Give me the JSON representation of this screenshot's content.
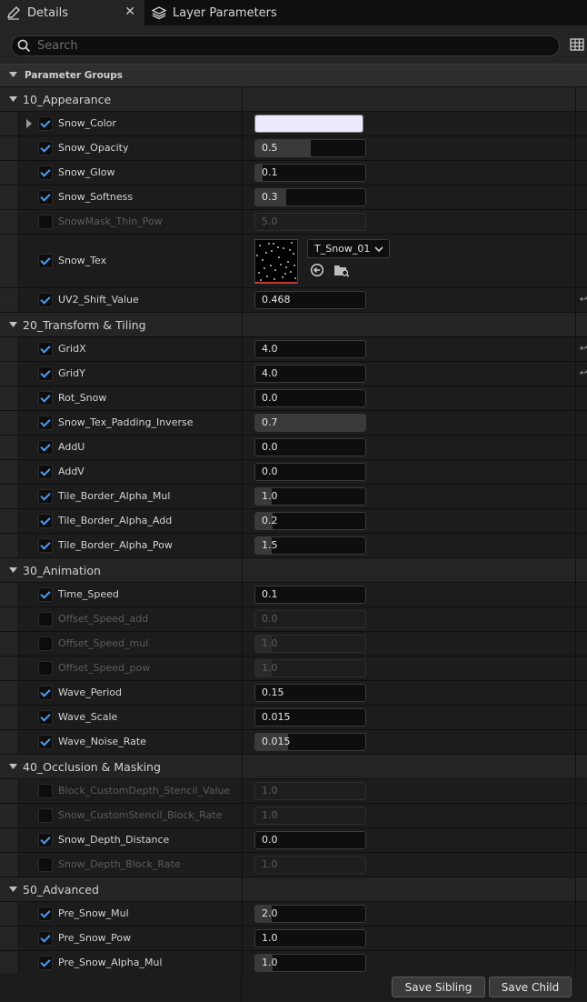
{
  "tabs": [
    {
      "label": "Details",
      "icon": "pencil-icon",
      "active": true
    },
    {
      "label": "Layer Parameters",
      "icon": "layers-icon",
      "active": false
    }
  ],
  "search": {
    "placeholder": "Search"
  },
  "header": {
    "label": "Parameter Groups"
  },
  "groups": [
    {
      "name": "10_Appearance",
      "params": [
        {
          "name": "Snow_Color",
          "checked": true,
          "type": "color",
          "color": "#ebeaff",
          "expandable": true
        },
        {
          "name": "Snow_Opacity",
          "checked": true,
          "value": "0.5",
          "fill": 0.5
        },
        {
          "name": "Snow_Glow",
          "checked": true,
          "value": "0.1",
          "fill": 0.07
        },
        {
          "name": "Snow_Softness",
          "checked": true,
          "value": "0.3",
          "fill": 0.28
        },
        {
          "name": "SnowMask_Thin_Pow",
          "checked": false,
          "value": "5.0",
          "fill": 0
        },
        {
          "name": "Snow_Tex",
          "checked": true,
          "type": "texture",
          "texture": "T_Snow_01"
        },
        {
          "name": "UV2_Shift_Value",
          "checked": true,
          "value": "0.468",
          "fill": 0,
          "reset": true
        }
      ]
    },
    {
      "name": "20_Transform & Tiling",
      "params": [
        {
          "name": "GridX",
          "checked": true,
          "value": "4.0",
          "fill": 0,
          "reset": true
        },
        {
          "name": "GridY",
          "checked": true,
          "value": "4.0",
          "fill": 0,
          "reset": true
        },
        {
          "name": "Rot_Snow",
          "checked": true,
          "value": "0.0",
          "fill": 0
        },
        {
          "name": "Snow_Tex_Padding_Inverse",
          "checked": true,
          "value": "0.7",
          "fill": 1.0
        },
        {
          "name": "AddU",
          "checked": true,
          "value": "0.0",
          "fill": 0
        },
        {
          "name": "AddV",
          "checked": true,
          "value": "0.0",
          "fill": 0
        },
        {
          "name": "Tile_Border_Alpha_Mul",
          "checked": true,
          "value": "1.0",
          "fill": 0.15
        },
        {
          "name": "Tile_Border_Alpha_Add",
          "checked": true,
          "value": "0.2",
          "fill": 0.16
        },
        {
          "name": "Tile_Border_Alpha_Pow",
          "checked": true,
          "value": "1.5",
          "fill": 0.15
        }
      ]
    },
    {
      "name": "30_Animation",
      "params": [
        {
          "name": "Time_Speed",
          "checked": true,
          "value": "0.1",
          "fill": 0
        },
        {
          "name": "Offset_Speed_add",
          "checked": false,
          "value": "0.0",
          "fill": 0
        },
        {
          "name": "Offset_Speed_mul",
          "checked": false,
          "value": "1.0",
          "fill": 0.15
        },
        {
          "name": "Offset_Speed_pow",
          "checked": false,
          "value": "1.0",
          "fill": 0.15
        },
        {
          "name": "Wave_Period",
          "checked": true,
          "value": "0.15",
          "fill": 0
        },
        {
          "name": "Wave_Scale",
          "checked": true,
          "value": "0.015",
          "fill": 0
        },
        {
          "name": "Wave_Noise_Rate",
          "checked": true,
          "value": "0.015",
          "fill": 0.3
        }
      ]
    },
    {
      "name": "40_Occlusion & Masking",
      "params": [
        {
          "name": "Block_CustomDepth_Stencil_Value",
          "checked": false,
          "value": "1.0",
          "fill": 0
        },
        {
          "name": "Snow_CustomStencil_Block_Rate",
          "checked": false,
          "value": "1.0",
          "fill": 0
        },
        {
          "name": "Snow_Depth_Distance",
          "checked": true,
          "value": "0.0",
          "fill": 0
        },
        {
          "name": "Snow_Depth_Block_Rate",
          "checked": false,
          "value": "1.0",
          "fill": 0
        }
      ]
    },
    {
      "name": "50_Advanced",
      "params": [
        {
          "name": "Pre_Snow_Mul",
          "checked": true,
          "value": "2.0",
          "fill": 0.15
        },
        {
          "name": "Pre_Snow_Pow",
          "checked": true,
          "value": "1.0",
          "fill": 0
        },
        {
          "name": "Pre_Snow_Alpha_Mul",
          "checked": true,
          "value": "1.0",
          "fill": 0.16
        }
      ]
    }
  ],
  "footer": {
    "save_sibling": "Save Sibling",
    "save_child": "Save Child"
  }
}
